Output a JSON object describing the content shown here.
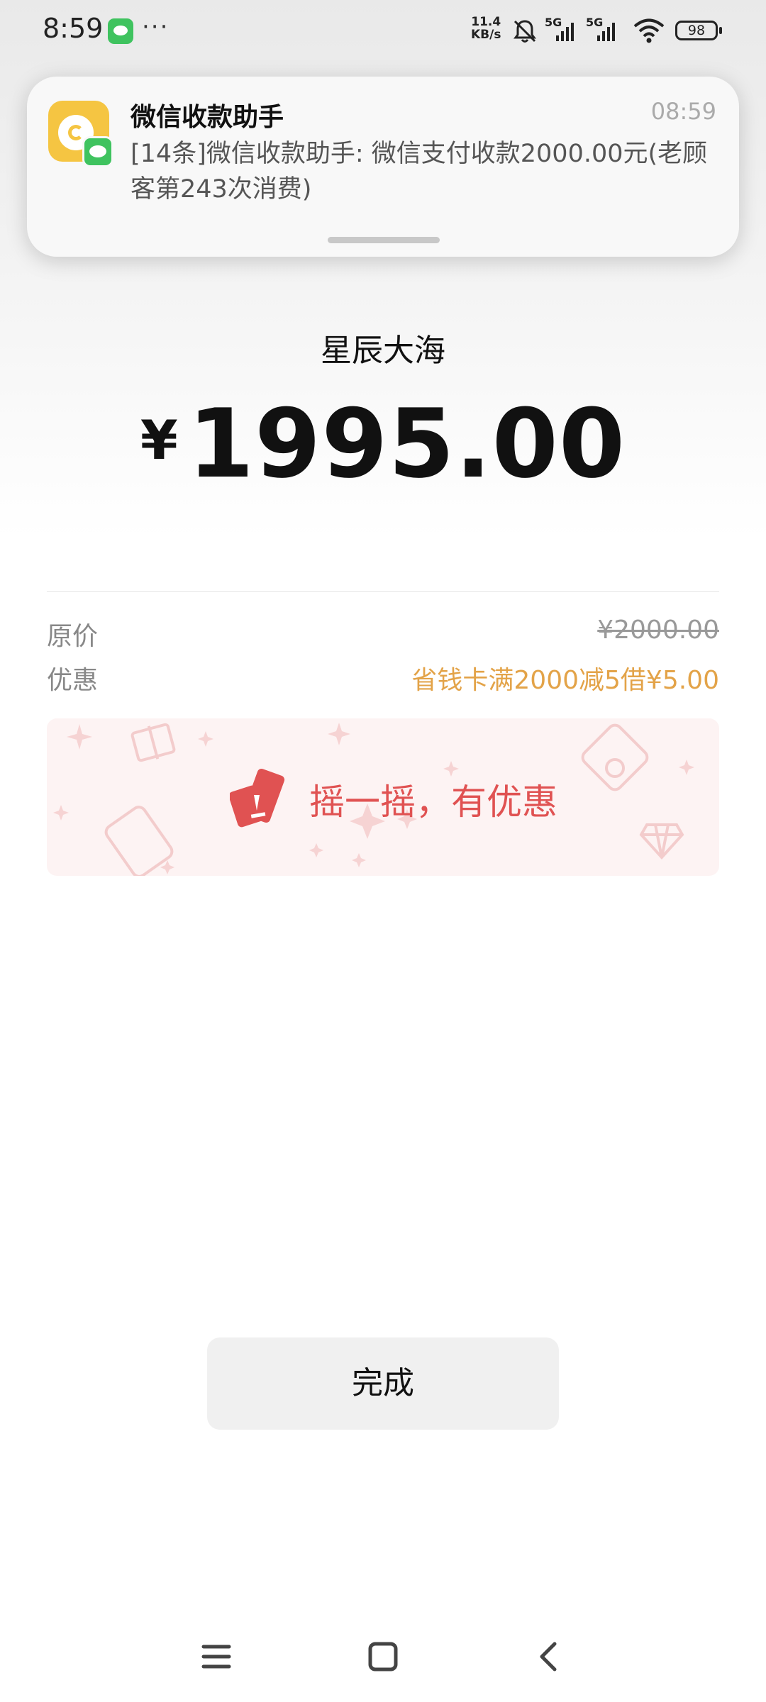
{
  "status_bar": {
    "time": "8:59",
    "more": "···",
    "net_speed_value": "11.4",
    "net_speed_unit": "KB/s",
    "signal_1": "5G",
    "signal_2": "5G",
    "battery": "98",
    "icons": [
      "wechat-icon",
      "bell-muted-icon",
      "signal-icon",
      "wifi-icon",
      "battery-icon"
    ]
  },
  "notification": {
    "app_name": "微信收款助手",
    "time": "08:59",
    "body": "[14条]微信收款助手: 微信支付收款2000.00元(老顾客第243次消费)",
    "icon": "wallet-app-icon",
    "badge_icon": "wechat-icon"
  },
  "receipt": {
    "merchant": "星辰大海",
    "currency_symbol": "¥",
    "amount": "1995.00",
    "original_price_label": "原价",
    "original_price": "¥2000.00",
    "discount_label": "优惠",
    "discount": "省钱卡满2000减5借¥5.00"
  },
  "banner": {
    "text": "摇一摇，有优惠",
    "icon": "shake-phone-icon",
    "accent_color": "#e05252"
  },
  "actions": {
    "done_label": "完成"
  },
  "nav": {
    "icons": [
      "menu-icon",
      "home-square-icon",
      "back-icon"
    ]
  },
  "colors": {
    "discount": "#e3a348",
    "button_bg": "#f0f0f0"
  }
}
